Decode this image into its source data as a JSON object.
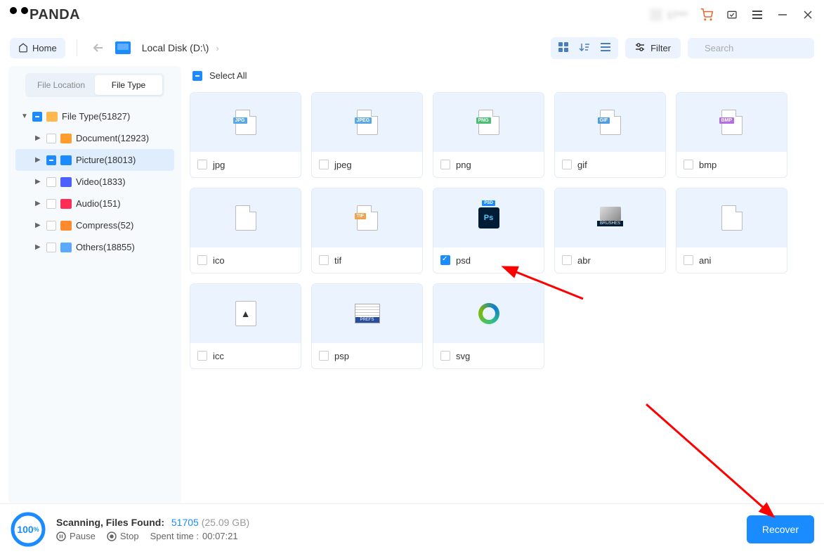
{
  "app_name": "PANDA",
  "titlebar_user": "17***",
  "toolbar": {
    "home": "Home",
    "disk_path": "Local Disk (D:\\)",
    "filter": "Filter",
    "search_placeholder": "Search"
  },
  "sidebar": {
    "tabs": {
      "location": "File Location",
      "type": "File Type"
    },
    "root": "File Type(51827)",
    "items": [
      {
        "label": "Document(12923)"
      },
      {
        "label": "Picture(18013)"
      },
      {
        "label": "Video(1833)"
      },
      {
        "label": "Audio(151)"
      },
      {
        "label": "Compress(52)"
      },
      {
        "label": "Others(18855)"
      }
    ]
  },
  "content": {
    "select_all": "Select All",
    "items": [
      {
        "label": "jpg",
        "checked": false
      },
      {
        "label": "jpeg",
        "checked": false
      },
      {
        "label": "png",
        "checked": false
      },
      {
        "label": "gif",
        "checked": false
      },
      {
        "label": "bmp",
        "checked": false
      },
      {
        "label": "ico",
        "checked": false
      },
      {
        "label": "tif",
        "checked": false
      },
      {
        "label": "psd",
        "checked": true
      },
      {
        "label": "abr",
        "checked": false
      },
      {
        "label": "ani",
        "checked": false
      },
      {
        "label": "icc",
        "checked": false
      },
      {
        "label": "psp",
        "checked": false
      },
      {
        "label": "svg",
        "checked": false
      }
    ]
  },
  "footer": {
    "progress_pct": "100",
    "progress_unit": "%",
    "scanning_label": "Scanning, Files Found:",
    "found_count": "51705",
    "found_size": "(25.09 GB)",
    "pause": "Pause",
    "stop": "Stop",
    "spent_label": "Spent time :",
    "spent_time": "00:07:21",
    "recover": "Recover"
  }
}
